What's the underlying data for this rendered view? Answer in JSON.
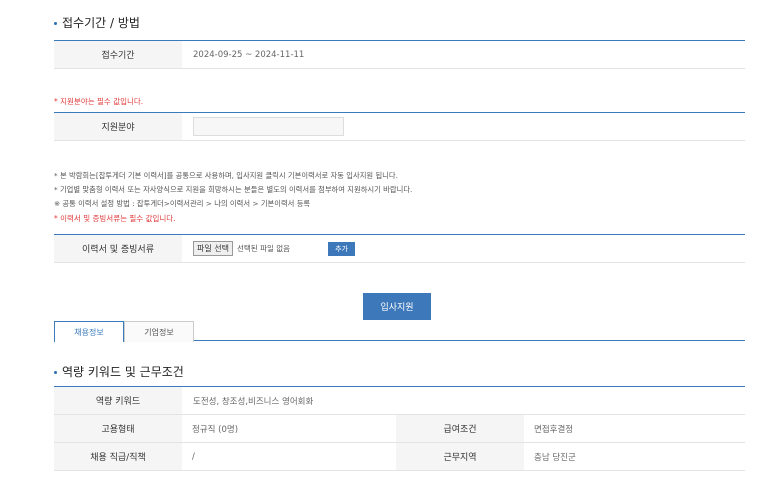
{
  "section1": {
    "title": "접수기간 / 방법",
    "period_label": "접수기간",
    "period_value": "2024-09-25 ~ 2024-11-11"
  },
  "field": {
    "required_note": "* 지원분야는 필수 값입니다.",
    "label": "지원분야",
    "value": ""
  },
  "notes": {
    "line1": "* 본 박람회는[잡투게더 기본 이력서]를 공통으로 사용하며, 입사지원 클릭시 기본이력서로 자동 입사지원 됩니다.",
    "line2": "* 기업별 맞춤형 이력서 또는 자사양식으로 지원을 희망하시는 분들은 별도의 이력서를 첨부하여 지원하시기 바랍니다.",
    "line3": "※ 공통 이력서 설정 방법 : 잡투게더>이력서관리 > 나의 이력서 > 기본이력서 등록",
    "line4": "* 이력서 및 증빙서류는 필수 값입니다."
  },
  "upload": {
    "label": "이력서 및 증빙서류",
    "file_button": "파일 선택",
    "file_status": "선택된 파일 없음",
    "add_button": "추가"
  },
  "apply_button": "입사지원",
  "tabs": [
    "채용정보",
    "기업정보"
  ],
  "section2": {
    "title": "역량 키워드 및 근무조건",
    "keyword_label": "역량 키워드",
    "keyword_value": "도전성, 창조성,비즈니스 영어회화",
    "employ_type_label": "고용형태",
    "employ_type_value": "정규직 (0명)",
    "salary_label": "급여조건",
    "salary_value": "면접후결정",
    "rank_label": "채용 직급/직책",
    "rank_value": "/",
    "region_label": "근무지역",
    "region_value": "충남 당진군"
  },
  "colors": {
    "accent": "#3d78ba",
    "required": "#e23a3a"
  }
}
